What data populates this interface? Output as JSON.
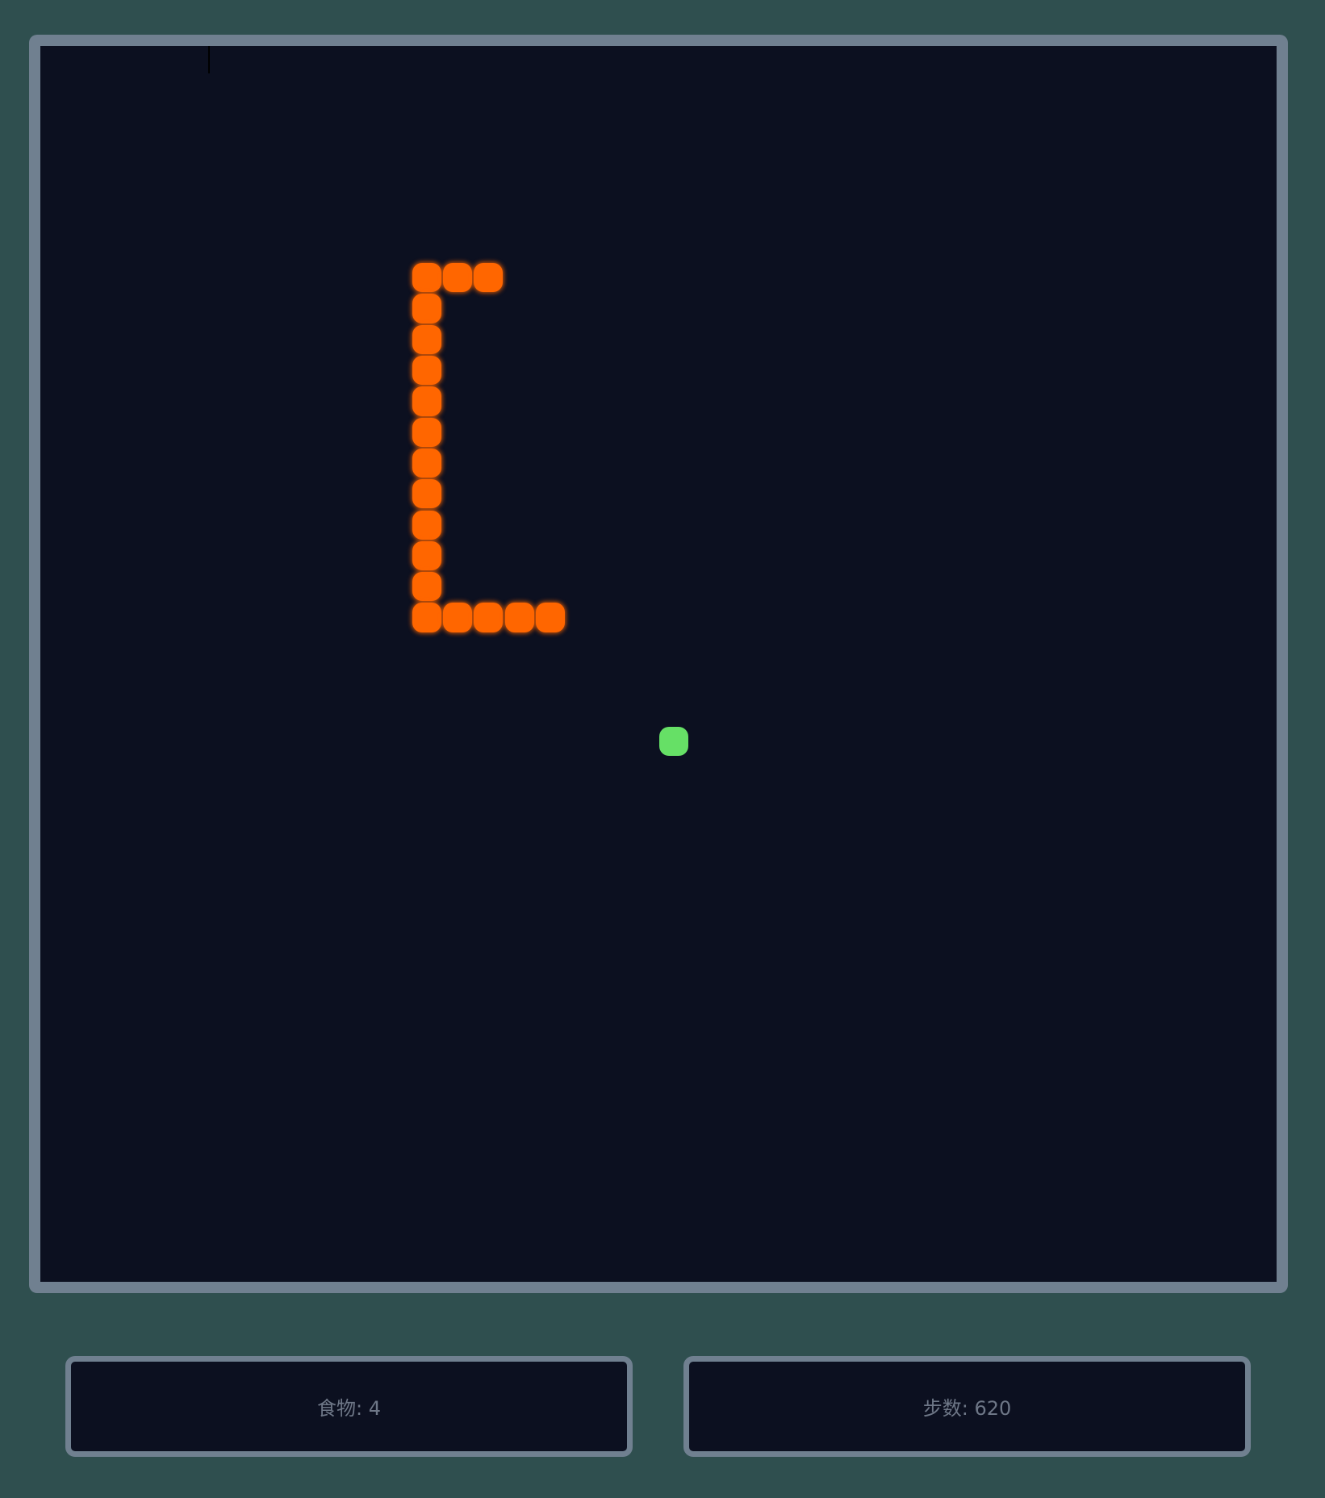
{
  "colors": {
    "page_background": "#2f4f4f",
    "board_background": "#0c1020",
    "border": "#708090",
    "snake": "#ff6600",
    "food": "#66e066",
    "stat_text": "#6e7787"
  },
  "game": {
    "grid_size": 40,
    "snake": [
      [
        12,
        7
      ],
      [
        13,
        7
      ],
      [
        14,
        7
      ],
      [
        12,
        8
      ],
      [
        12,
        9
      ],
      [
        12,
        10
      ],
      [
        12,
        11
      ],
      [
        12,
        12
      ],
      [
        12,
        13
      ],
      [
        12,
        14
      ],
      [
        12,
        15
      ],
      [
        12,
        16
      ],
      [
        12,
        17
      ],
      [
        12,
        18
      ],
      [
        13,
        18
      ],
      [
        14,
        18
      ],
      [
        15,
        18
      ],
      [
        16,
        18
      ]
    ],
    "food": [
      20,
      22
    ]
  },
  "stats": {
    "food": "食物: 4",
    "steps": "步数: 620"
  }
}
